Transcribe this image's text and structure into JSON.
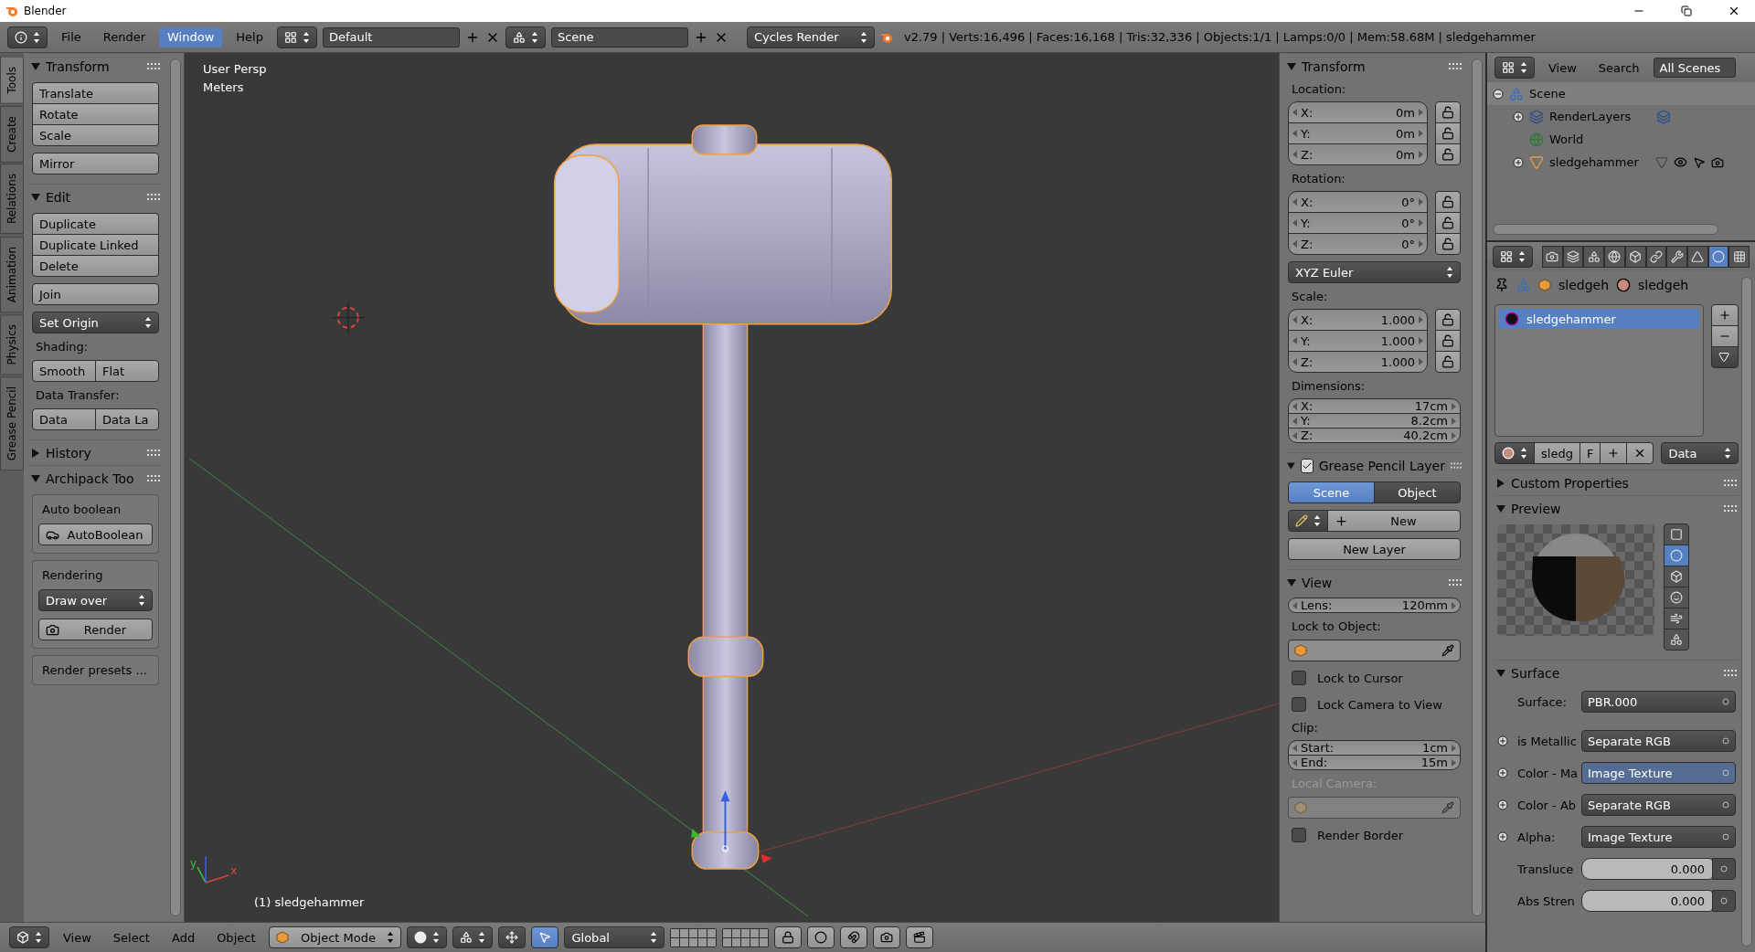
{
  "window": {
    "title": "Blender"
  },
  "info_header": {
    "menus": [
      {
        "label": "File",
        "selected": false
      },
      {
        "label": "Render",
        "selected": false
      },
      {
        "label": "Window",
        "selected": true
      },
      {
        "label": "Help",
        "selected": false
      }
    ],
    "screen_layout": "Default",
    "scene": "Scene",
    "render_engine": "Cycles Render",
    "stats": "v2.79 | Verts:16,496 | Faces:16,168 | Tris:32,336 | Objects:1/1 | Lamps:0/0 | Mem:58.68M | sledgehammer"
  },
  "tool_tabs": [
    {
      "label": "Tools",
      "selected": true
    },
    {
      "label": "Create",
      "selected": false
    },
    {
      "label": "Relations",
      "selected": false
    },
    {
      "label": "Animation",
      "selected": false
    },
    {
      "label": "Physics",
      "selected": false
    },
    {
      "label": "Grease Pencil",
      "selected": false
    }
  ],
  "tool_shelf": {
    "panels": [
      {
        "title": "Transform",
        "expanded": true,
        "items": [
          {
            "kind": "column",
            "buttons": [
              "Translate",
              "Rotate",
              "Scale"
            ]
          },
          {
            "kind": "column",
            "buttons": [
              "Mirror"
            ]
          }
        ]
      },
      {
        "title": "Edit",
        "expanded": true,
        "items": [
          {
            "kind": "column",
            "buttons": [
              "Duplicate",
              "Duplicate Linked",
              "Delete"
            ]
          },
          {
            "kind": "column",
            "buttons": [
              "Join"
            ]
          },
          {
            "kind": "dropdown",
            "label": "Set Origin"
          },
          {
            "kind": "label",
            "text": "Shading:"
          },
          {
            "kind": "row",
            "buttons": [
              "Smooth",
              "Flat"
            ]
          },
          {
            "kind": "label",
            "text": "Data Transfer:"
          },
          {
            "kind": "row",
            "buttons": [
              "Data",
              "Data La"
            ]
          }
        ]
      },
      {
        "title": "History",
        "expanded": false
      },
      {
        "title": "Archipack Too",
        "expanded": true,
        "items": [
          {
            "kind": "box",
            "items": [
              {
                "kind": "label",
                "text": "Auto boolean"
              },
              {
                "kind": "icon_button",
                "label": "AutoBoolean"
              }
            ]
          },
          {
            "kind": "box",
            "items": [
              {
                "kind": "label",
                "text": "Rendering"
              },
              {
                "kind": "dropdown",
                "label": "Draw over"
              },
              {
                "kind": "icon_button",
                "label": "Render"
              }
            ]
          },
          {
            "kind": "box",
            "items": [
              {
                "kind": "label",
                "text": "Render presets ..."
              }
            ]
          }
        ]
      }
    ]
  },
  "viewport": {
    "view_name": "User Persp",
    "units": "Meters",
    "active_object": "(1) sledgehammer",
    "axis_labels": [
      "y",
      "x"
    ]
  },
  "properties_region": {
    "panels": [
      {
        "title": "Transform",
        "expanded": true,
        "items": [
          {
            "kind": "label",
            "text": "Location:",
            "disabled": false
          },
          {
            "kind": "vector",
            "fields": [
              {
                "label": "X:",
                "value": "0m",
                "locked": false
              },
              {
                "label": "Y:",
                "value": "0m",
                "locked": false
              },
              {
                "label": "Z:",
                "value": "0m",
                "locked": false
              }
            ]
          },
          {
            "kind": "label",
            "text": "Rotation:",
            "disabled": false
          },
          {
            "kind": "vector",
            "fields": [
              {
                "label": "X:",
                "value": "0°",
                "locked": false
              },
              {
                "label": "Y:",
                "value": "0°",
                "locked": false
              },
              {
                "label": "Z:",
                "value": "0°",
                "locked": false
              }
            ]
          },
          {
            "kind": "dropdown",
            "label": "XYZ Euler"
          },
          {
            "kind": "label",
            "text": "Scale:",
            "disabled": false
          },
          {
            "kind": "vector",
            "fields": [
              {
                "label": "X:",
                "value": "1.000",
                "locked": false
              },
              {
                "label": "Y:",
                "value": "1.000",
                "locked": false
              },
              {
                "label": "Z:",
                "value": "1.000",
                "locked": false
              }
            ]
          },
          {
            "kind": "label",
            "text": "Dimensions:",
            "disabled": false
          },
          {
            "kind": "vector",
            "fields": [
              {
                "label": "X:",
                "value": "17cm"
              },
              {
                "label": "Y:",
                "value": "8.2cm"
              },
              {
                "label": "Z:",
                "value": "40.2cm"
              }
            ]
          }
        ]
      },
      {
        "title": "Grease Pencil Layer",
        "expanded": true,
        "checked": true,
        "items": [
          {
            "kind": "toggle",
            "options": [
              {
                "label": "Scene",
                "selected": true
              },
              {
                "label": "Object",
                "selected": false
              }
            ]
          },
          {
            "kind": "new",
            "label": "New"
          },
          {
            "kind": "button",
            "label": "New Layer"
          }
        ]
      },
      {
        "title": "View",
        "expanded": true,
        "items": [
          {
            "kind": "vector",
            "fields": [
              {
                "label": "Lens:",
                "value": "120mm"
              }
            ]
          },
          {
            "kind": "label",
            "text": "Lock to Object:",
            "disabled": false
          },
          {
            "kind": "object_field",
            "disabled": false
          },
          {
            "kind": "checkbox",
            "label": "Lock to Cursor",
            "checked": false
          },
          {
            "kind": "checkbox",
            "label": "Lock Camera to View",
            "checked": false
          },
          {
            "kind": "label",
            "text": "Clip:",
            "disabled": false
          },
          {
            "kind": "vector",
            "fields": [
              {
                "label": "Start:",
                "value": "1cm"
              },
              {
                "label": "End:",
                "value": "15m"
              }
            ]
          },
          {
            "kind": "label",
            "text": "Local Camera:",
            "disabled": true
          },
          {
            "kind": "object_field",
            "disabled": true
          },
          {
            "kind": "checkbox",
            "label": "Render Border",
            "checked": false
          }
        ]
      }
    ]
  },
  "outliner": {
    "menus": [
      "View",
      "Search"
    ],
    "display_mode": "All Scenes",
    "tree": [
      {
        "name": "Scene",
        "kind": "scene",
        "selected": true,
        "expanded": true,
        "children": [
          {
            "name": "RenderLayers",
            "kind": "render_layers",
            "selected": false,
            "expanded": false
          },
          {
            "name": "World",
            "kind": "world",
            "selected": false
          },
          {
            "name": "sledgehammer",
            "kind": "mesh_object",
            "selected": false,
            "expanded": false
          }
        ]
      }
    ]
  },
  "properties_editor": {
    "tabs": [
      {
        "selected": false
      },
      {
        "selected": false
      },
      {
        "selected": false
      },
      {
        "selected": false
      },
      {
        "selected": false
      },
      {
        "selected": false
      },
      {
        "selected": false
      },
      {
        "selected": false
      },
      {
        "selected": true
      },
      {
        "selected": false
      }
    ],
    "breadcrumb": [
      "sledgeh",
      "sledgeh"
    ],
    "material_slots": [
      {
        "name": "sledgehammer",
        "selected": true
      }
    ],
    "material": {
      "name": "sledg",
      "fake_user": "F",
      "link": "Data"
    },
    "panels": [
      {
        "kind": "plain",
        "title": "Custom Properties",
        "expanded": false
      },
      {
        "kind": "preview",
        "title": "Preview",
        "expanded": true,
        "preview_types": [
          {
            "selected": false
          },
          {
            "selected": true
          },
          {
            "selected": false
          },
          {
            "selected": false
          },
          {
            "selected": false
          },
          {
            "selected": false
          }
        ]
      },
      {
        "kind": "surface",
        "title": "Surface",
        "expanded": true,
        "rows": [
          {
            "kind": "shader",
            "label": "Surface:",
            "value": "PBR.000",
            "selected": false
          },
          {
            "kind": "link",
            "label": "is Metallic",
            "value": "Separate RGB",
            "selected": false
          },
          {
            "kind": "link",
            "label": "Color - Ma",
            "value": "Image Texture",
            "selected": true
          },
          {
            "kind": "link",
            "label": "Color - Ab",
            "value": "Separate RGB",
            "selected": false
          },
          {
            "kind": "link",
            "label": "Alpha:",
            "value": "Image Texture",
            "selected": false
          },
          {
            "kind": "value",
            "label": "Transluce",
            "value": "0.000",
            "selected": false
          },
          {
            "kind": "value",
            "label": "Abs Stren",
            "value": "0.000",
            "selected": false
          }
        ]
      }
    ]
  },
  "bottom_header": {
    "menus": [
      "View",
      "Select",
      "Add",
      "Object"
    ],
    "mode": "Object Mode",
    "orientation": "Global"
  }
}
